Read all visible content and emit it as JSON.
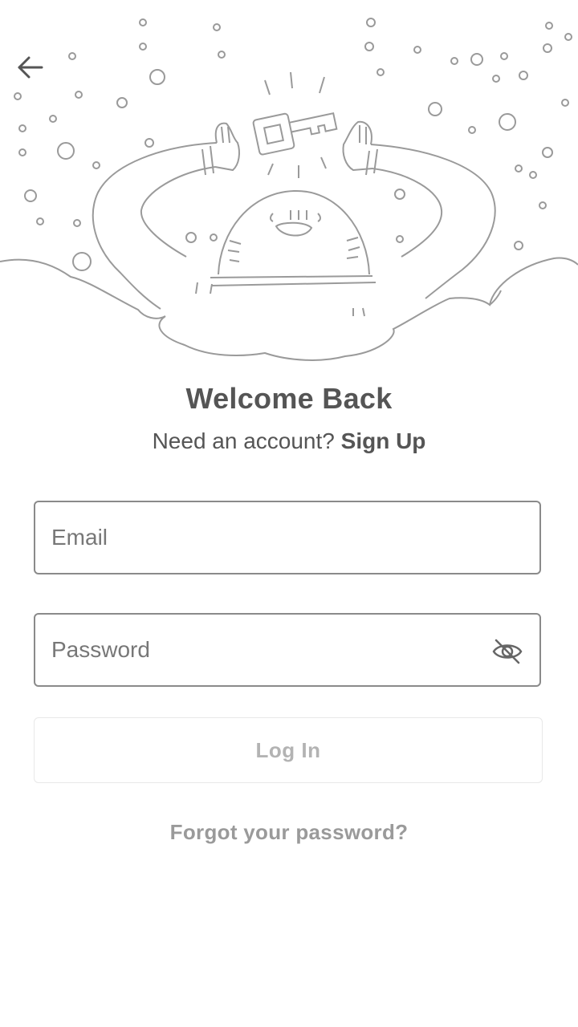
{
  "header": {
    "back_icon": "arrow-left-icon"
  },
  "hero": {
    "illustration": "character-holding-key-illustration"
  },
  "welcome": {
    "title": "Welcome Back",
    "prompt": "Need an account?",
    "signup_label": "Sign Up"
  },
  "form": {
    "email": {
      "value": "",
      "placeholder": "Email"
    },
    "password": {
      "value": "",
      "placeholder": "Password",
      "toggle_icon": "eye-off-icon"
    },
    "login_label": "Log In",
    "forgot_label": "Forgot your password?"
  },
  "colors": {
    "text": "#555555",
    "border": "#8a8a8a",
    "disabled": "#b3b3b3"
  }
}
